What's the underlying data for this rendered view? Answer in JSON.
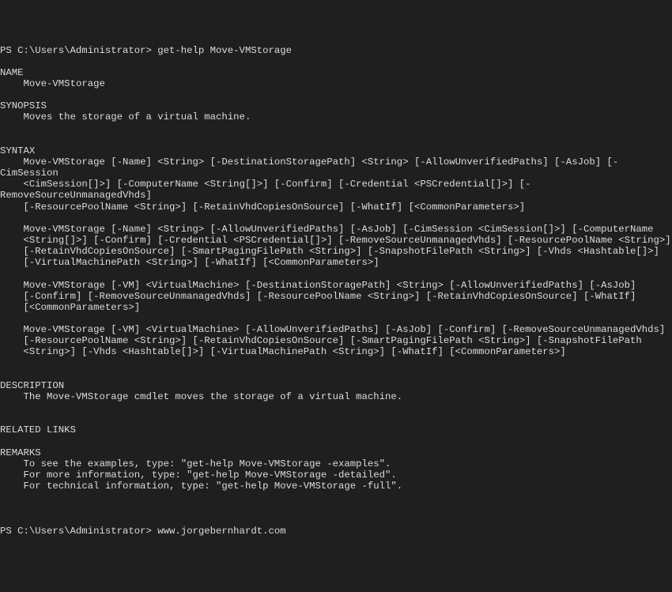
{
  "prompt1": "PS C:\\Users\\Administrator> ",
  "command1": "get-help Move-VMStorage",
  "blank": "",
  "nameHeader": "NAME",
  "nameValue": "    Move-VMStorage",
  "synopsisHeader": "SYNOPSIS",
  "synopsisValue": "    Moves the storage of a virtual machine.",
  "syntaxHeader": "SYNTAX",
  "syntax1_l1": "    Move-VMStorage [-Name] <String> [-DestinationStoragePath] <String> [-AllowUnverifiedPaths] [-AsJob] [-CimSession",
  "syntax1_l2": "    <CimSession[]>] [-ComputerName <String[]>] [-Confirm] [-Credential <PSCredential[]>] [-RemoveSourceUnmanagedVhds]",
  "syntax1_l3": "    [-ResourcePoolName <String>] [-RetainVhdCopiesOnSource] [-WhatIf] [<CommonParameters>]",
  "syntax2_l1": "    Move-VMStorage [-Name] <String> [-AllowUnverifiedPaths] [-AsJob] [-CimSession <CimSession[]>] [-ComputerName",
  "syntax2_l2": "    <String[]>] [-Confirm] [-Credential <PSCredential[]>] [-RemoveSourceUnmanagedVhds] [-ResourcePoolName <String>]",
  "syntax2_l3": "    [-RetainVhdCopiesOnSource] [-SmartPagingFilePath <String>] [-SnapshotFilePath <String>] [-Vhds <Hashtable[]>]",
  "syntax2_l4": "    [-VirtualMachinePath <String>] [-WhatIf] [<CommonParameters>]",
  "syntax3_l1": "    Move-VMStorage [-VM] <VirtualMachine> [-DestinationStoragePath] <String> [-AllowUnverifiedPaths] [-AsJob]",
  "syntax3_l2": "    [-Confirm] [-RemoveSourceUnmanagedVhds] [-ResourcePoolName <String>] [-RetainVhdCopiesOnSource] [-WhatIf]",
  "syntax3_l3": "    [<CommonParameters>]",
  "syntax4_l1": "    Move-VMStorage [-VM] <VirtualMachine> [-AllowUnverifiedPaths] [-AsJob] [-Confirm] [-RemoveSourceUnmanagedVhds]",
  "syntax4_l2": "    [-ResourcePoolName <String>] [-RetainVhdCopiesOnSource] [-SmartPagingFilePath <String>] [-SnapshotFilePath",
  "syntax4_l3": "    <String>] [-Vhds <Hashtable[]>] [-VirtualMachinePath <String>] [-WhatIf] [<CommonParameters>]",
  "descriptionHeader": "DESCRIPTION",
  "descriptionValue": "    The Move-VMStorage cmdlet moves the storage of a virtual machine.",
  "relatedLinksHeader": "RELATED LINKS",
  "remarksHeader": "REMARKS",
  "remarks1": "    To see the examples, type: \"get-help Move-VMStorage -examples\".",
  "remarks2": "    For more information, type: \"get-help Move-VMStorage -detailed\".",
  "remarks3": "    For technical information, type: \"get-help Move-VMStorage -full\".",
  "prompt2": "PS C:\\Users\\Administrator> ",
  "command2": "www.jorgebernhardt.com"
}
